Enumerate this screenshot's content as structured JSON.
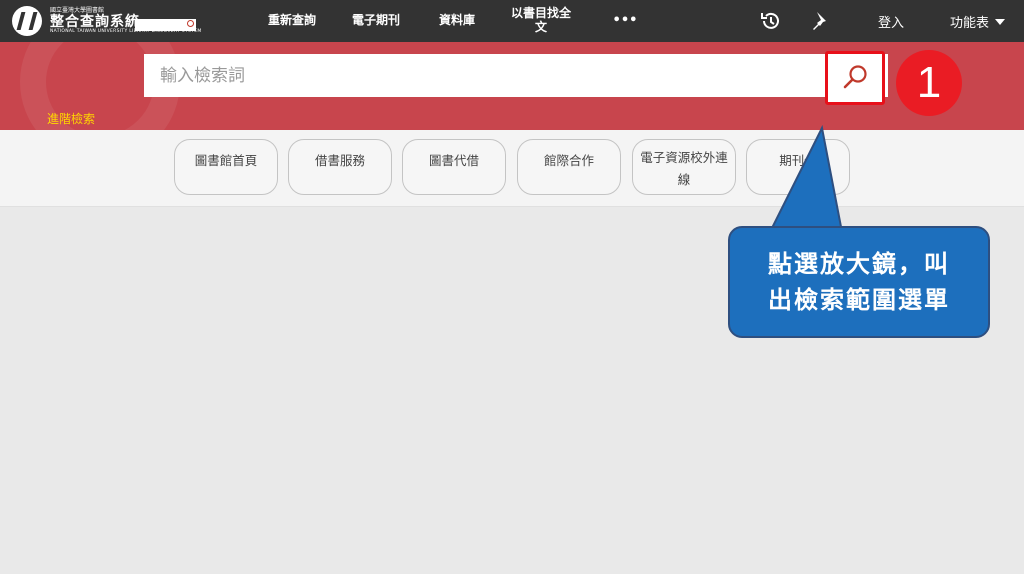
{
  "header": {
    "logo_small": "國立臺灣大學圖書館",
    "logo_title": "整合查詢系統",
    "logo_sub": "NATIONAL TAIWAN UNIVERSITY LIBRARY DISCOVERY SYSTEM",
    "nav": [
      "重新查詢",
      "電子期刊",
      "資料庫",
      "以書目找全文",
      "•••"
    ],
    "login_label": "登入",
    "menu_label": "功能表"
  },
  "search": {
    "placeholder": "輸入檢索詞",
    "advanced_label": "進階檢索",
    "step_number": "1"
  },
  "quick_links": [
    "圖書館首頁",
    "借書服務",
    "圖書代借",
    "館際合作",
    "電子資源校外連線",
    "期刊代"
  ],
  "callout": {
    "line1": "點選放大鏡，叫",
    "line2": "出檢索範圍選單"
  },
  "colors": {
    "topbar": "#333333",
    "search_band": "#c8454d",
    "highlight": "#e8101a",
    "callout": "#1d6fbd",
    "advanced_link": "#ffd700"
  },
  "icons": [
    "history-icon",
    "pin-icon",
    "search-icon",
    "caret-down-icon"
  ]
}
